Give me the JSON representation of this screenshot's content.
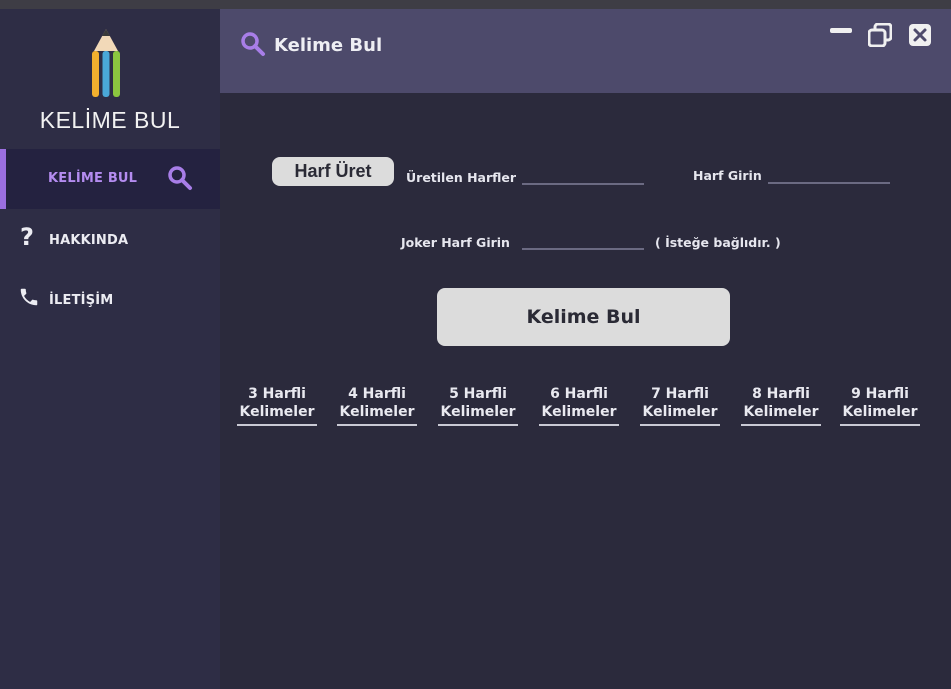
{
  "app": {
    "logo_text": "KELİME BUL"
  },
  "sidebar": {
    "items": [
      {
        "label": "KELİME BUL",
        "icon": "search-icon",
        "active": true
      },
      {
        "label": "HAKKINDA",
        "icon": "question-icon",
        "active": false
      },
      {
        "label": "İLETİŞİM",
        "icon": "phone-icon",
        "active": false
      }
    ]
  },
  "header": {
    "title": "Kelime Bul",
    "icon": "search-icon"
  },
  "form": {
    "harf_uret_label": "Harf Üret",
    "uretilen_harfler_label": "Üretilen Harfler",
    "uretilen_harfler_value": "",
    "harf_girin_label": "Harf Girin",
    "harf_girin_value": "",
    "joker_label": "Joker Harf Girin",
    "joker_value": "",
    "joker_hint": "( İsteğe bağlıdır. )",
    "kelime_bul_label": "Kelime Bul"
  },
  "word_lengths": [
    {
      "line1": "3 Harfli",
      "line2": "Kelimeler"
    },
    {
      "line1": "4 Harfli",
      "line2": "Kelimeler"
    },
    {
      "line1": "5 Harfli",
      "line2": "Kelimeler"
    },
    {
      "line1": "6 Harfli",
      "line2": "Kelimeler"
    },
    {
      "line1": "7 Harfli",
      "line2": "Kelimeler"
    },
    {
      "line1": "8 Harfli",
      "line2": "Kelimeler"
    },
    {
      "line1": "9 Harfli",
      "line2": "Kelimeler"
    }
  ],
  "colors": {
    "accent": "#9b6fe0",
    "sidebar_bg": "#2e2d45",
    "header_bg": "#4d4a6b",
    "content_bg": "#2b2a3c"
  }
}
